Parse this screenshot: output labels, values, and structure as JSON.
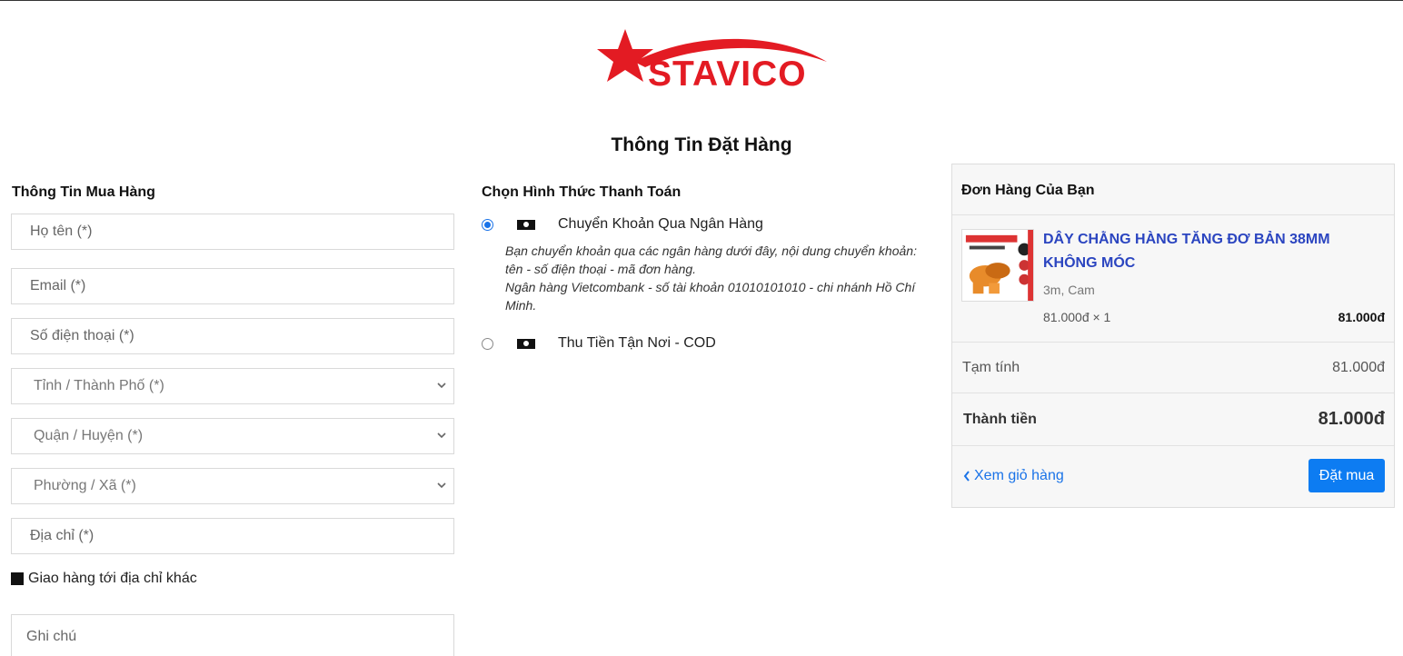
{
  "brand": {
    "name": "STAVICO",
    "color": "#e31b23"
  },
  "page_title": "Thông Tin Đặt Hàng",
  "buyer": {
    "title": "Thông Tin Mua Hàng",
    "name_placeholder": "Họ tên (*)",
    "email_placeholder": "Email (*)",
    "phone_placeholder": "Số điện thoại (*)",
    "province": "Tỉnh / Thành Phố (*)",
    "district": "Quận / Huyện (*)",
    "ward": "Phường / Xã (*)",
    "address_placeholder": "Địa chỉ (*)",
    "ship_other_label": "Giao hàng tới địa chỉ khác",
    "note_placeholder": "Ghi chú"
  },
  "payment": {
    "title": "Chọn Hình Thức Thanh Toán",
    "options": [
      {
        "label": "Chuyển Khoản Qua Ngân Hàng",
        "selected": true,
        "icon": "money-icon"
      },
      {
        "label": "Thu Tiền Tận Nơi - COD",
        "selected": false,
        "icon": "money-icon"
      }
    ],
    "bank_desc_1": "Bạn chuyển khoản qua các ngân hàng dưới đây, nội dung chuyển khoản: tên - số điện thoại - mã đơn hàng.",
    "bank_desc_2": "Ngân hàng Vietcombank - số tài khoản 01010101010 - chi nhánh Hồ Chí Minh."
  },
  "order": {
    "title": "Đơn Hàng Của Bạn",
    "item": {
      "name": "DÂY CHẰNG HÀNG TĂNG ĐƠ BẢN 38MM KHÔNG MÓC",
      "variant": "3m, Cam",
      "qty_text": "81.000đ × 1",
      "total": "81.000đ"
    },
    "subtotal_label": "Tạm tính",
    "subtotal_value": "81.000đ",
    "total_label": "Thành tiền",
    "total_value": "81.000đ",
    "back_label": "Xem giỏ hàng",
    "buy_label": "Đặt mua"
  },
  "colors": {
    "accent": "#0d7cf2",
    "link": "#1a73e8",
    "product_link": "#2b45c0"
  }
}
